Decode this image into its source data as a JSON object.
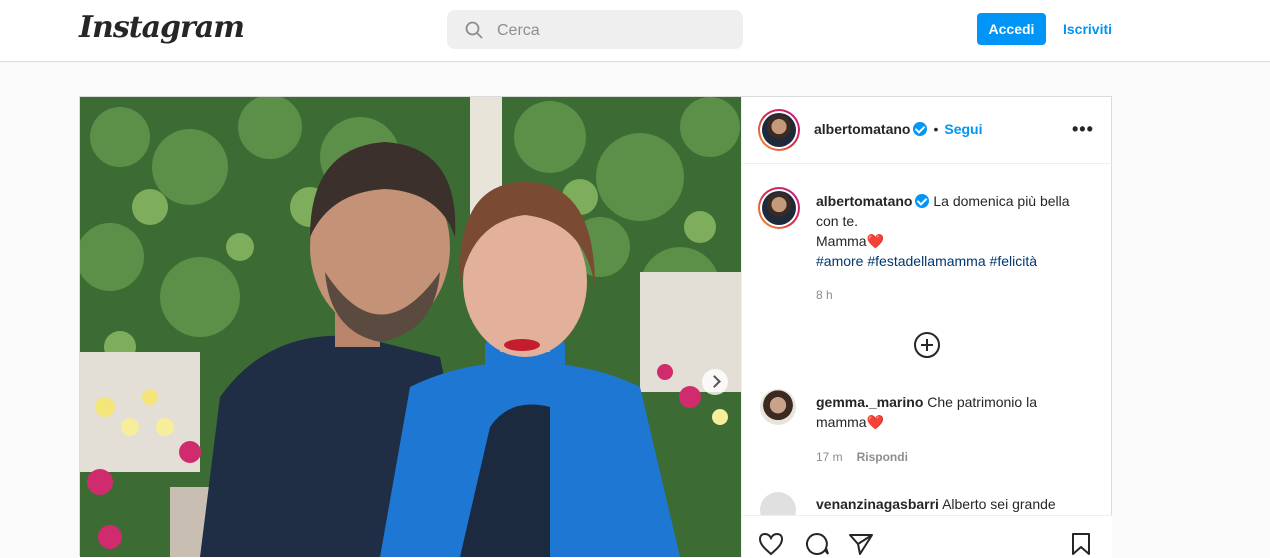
{
  "header": {
    "logo_text": "Instagram",
    "search_placeholder": "Cerca",
    "login_label": "Accedi",
    "signup_label": "Iscriviti"
  },
  "post": {
    "author": {
      "username": "albertomatano",
      "verified": true,
      "follow_label": "Segui",
      "separator": "•"
    },
    "caption": {
      "line1": "La domenica più bella",
      "line2": "con te.",
      "line3": "Mamma",
      "line3_emoji": "❤️",
      "hashtags": [
        "#amore",
        "#festadellamamma",
        "#felicità"
      ],
      "time": "8 h"
    },
    "comments": [
      {
        "username": "gemma._marino",
        "text_line1": "Che patrimonio la",
        "text_line2": "mamma",
        "emoji": "❤️",
        "time": "17 m",
        "reply_label": "Rispondi"
      },
      {
        "username": "venanzinagasbarri",
        "text": "Alberto sei grande"
      }
    ],
    "more_label": "•••"
  },
  "colors": {
    "accent": "#0095f6",
    "hashtag": "#00376b",
    "muted": "#8e8e8e",
    "border": "#dbdbdb"
  }
}
